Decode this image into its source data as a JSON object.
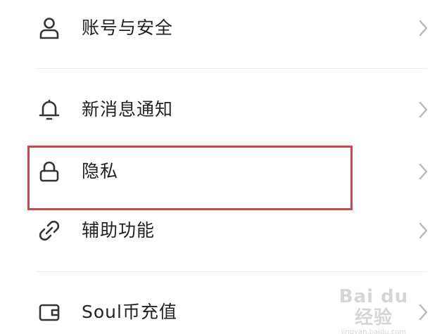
{
  "settings": {
    "items": [
      {
        "label": "账号与安全",
        "icon": "person-icon"
      },
      {
        "label": "新消息通知",
        "icon": "bell-icon"
      },
      {
        "label": "隐私",
        "icon": "lock-icon"
      },
      {
        "label": "辅助功能",
        "icon": "link-icon"
      },
      {
        "label": "Soul币充值",
        "icon": "wallet-icon"
      }
    ]
  },
  "highlight": {
    "target": "隐私",
    "color": "#c8484f"
  },
  "watermark": {
    "logo": "Bai du 经验",
    "url": "jingyan.baidu.com"
  },
  "colors": {
    "text": "#222222",
    "icon": "#333333",
    "chevron": "#b8b8b8",
    "divider": "#ececec",
    "highlight": "#c8484f"
  }
}
